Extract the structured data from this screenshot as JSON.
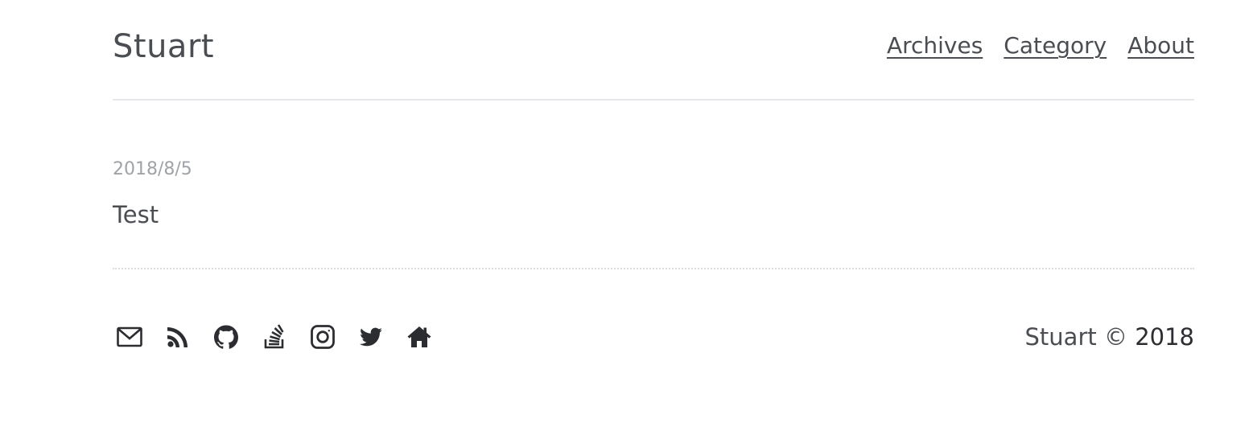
{
  "header": {
    "site_title": "Stuart",
    "nav": [
      {
        "label": "Archives"
      },
      {
        "label": "Category"
      },
      {
        "label": "About"
      }
    ]
  },
  "post": {
    "date": "2018/8/5",
    "title": "Test"
  },
  "footer": {
    "icons": [
      "mail-icon",
      "rss-icon",
      "github-icon",
      "stackoverflow-icon",
      "instagram-icon",
      "twitter-icon",
      "home-icon"
    ],
    "copyright_name": "Stuart",
    "copyright_symbol": "©",
    "copyright_year": "2018"
  },
  "colors": {
    "text": "#4a4d52",
    "muted": "#9fa3a9",
    "icon": "#2b2d31",
    "divider": "#e6e7ea"
  }
}
